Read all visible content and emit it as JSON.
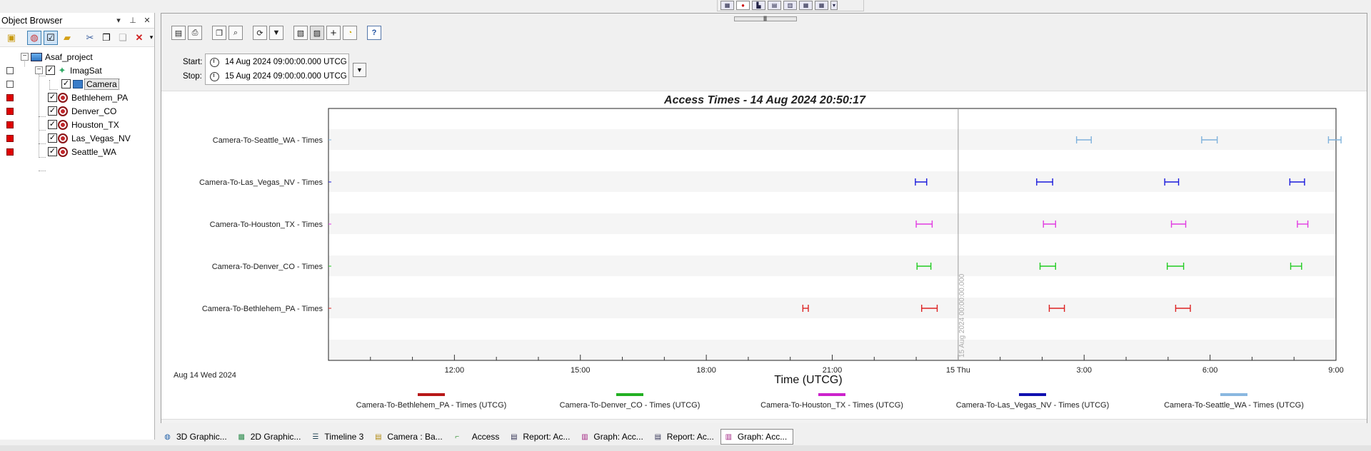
{
  "object_browser": {
    "title": "Object Browser",
    "title_controls": [
      "▾",
      "📌",
      "✕"
    ],
    "tree": [
      {
        "label": "Asaf_project",
        "icon": "project-icon",
        "status": "none",
        "level": 0
      },
      {
        "label": "ImagSat",
        "icon": "satellite-icon",
        "status": "white",
        "level": 1
      },
      {
        "label": "Camera",
        "icon": "sensor-icon",
        "status": "white",
        "level": 2
      },
      {
        "label": "Bethlehem_PA",
        "icon": "target-icon",
        "status": "red",
        "level": 1
      },
      {
        "label": "Denver_CO",
        "icon": "target-icon",
        "status": "red",
        "level": 1
      },
      {
        "label": "Houston_TX",
        "icon": "target-icon",
        "status": "red",
        "level": 1
      },
      {
        "label": "Las_Vegas_NV",
        "icon": "target-icon",
        "status": "red",
        "level": 1
      },
      {
        "label": "Seattle_WA",
        "icon": "target-icon",
        "status": "red",
        "level": 1
      }
    ]
  },
  "graph_window": {
    "start_label": "Start:",
    "stop_label": "Stop:",
    "start_time": "14 Aug 2024 09:00:00.000 UTCG",
    "stop_time": "15 Aug 2024 09:00:00.000 UTCG"
  },
  "chart_data": {
    "type": "gantt",
    "title": "Access Times - 14 Aug 2024 20:50:17",
    "xlabel": "Time (UTCG)",
    "date_label": "Aug 14 Wed 2024",
    "x_range": [
      "2024-08-14T09:00:00Z",
      "2024-08-15T09:00:00Z"
    ],
    "x_ticks": [
      "12:00",
      "15:00",
      "18:00",
      "21:00",
      "15 Thu",
      "3:00",
      "6:00",
      "9:00"
    ],
    "x_tick_hours": [
      3,
      6,
      9,
      12,
      15,
      18,
      21,
      24
    ],
    "marker": {
      "hours": 15,
      "label": "15 Aug 2024 00:00:00.000"
    },
    "series": [
      {
        "name": "Camera-To-Seattle_WA - Times",
        "color": "#7fb2dc",
        "intervals": [
          [
            17.82,
            18.17
          ],
          [
            20.8,
            21.17
          ],
          [
            23.82,
            24.12
          ]
        ]
      },
      {
        "name": "Camera-To-Las_Vegas_NV - Times",
        "color": "#1a1adc",
        "intervals": [
          [
            13.98,
            14.25
          ],
          [
            16.87,
            17.25
          ],
          [
            19.92,
            20.25
          ],
          [
            22.9,
            23.25
          ]
        ]
      },
      {
        "name": "Camera-To-Houston_TX - Times",
        "color": "#e23ce2",
        "intervals": [
          [
            14.0,
            14.38
          ],
          [
            17.03,
            17.32
          ],
          [
            20.08,
            20.42
          ],
          [
            23.08,
            23.33
          ]
        ]
      },
      {
        "name": "Camera-To-Denver_CO - Times",
        "color": "#22cc22",
        "intervals": [
          [
            14.02,
            14.35
          ],
          [
            16.95,
            17.32
          ],
          [
            19.98,
            20.37
          ],
          [
            22.92,
            23.18
          ]
        ]
      },
      {
        "name": "Camera-To-Bethlehem_PA - Times",
        "color": "#dd2222",
        "intervals": [
          [
            11.3,
            11.43
          ],
          [
            14.13,
            14.5
          ],
          [
            17.17,
            17.53
          ],
          [
            20.18,
            20.53
          ]
        ]
      }
    ],
    "legend": [
      {
        "label": "Camera-To-Bethlehem_PA - Times (UTCG)",
        "color": "#b81818"
      },
      {
        "label": "Camera-To-Denver_CO - Times (UTCG)",
        "color": "#22b022"
      },
      {
        "label": "Camera-To-Houston_TX - Times (UTCG)",
        "color": "#cc22cc"
      },
      {
        "label": "Camera-To-Las_Vegas_NV - Times (UTCG)",
        "color": "#1010b0"
      },
      {
        "label": "Camera-To-Seattle_WA - Times (UTCG)",
        "color": "#8ab8e0"
      }
    ],
    "legend_position": "bottom"
  },
  "tabs": [
    {
      "label": "3D Graphic...",
      "icon": "globe-icon"
    },
    {
      "label": "2D Graphic...",
      "icon": "map-icon"
    },
    {
      "label": "Timeline 3",
      "icon": "timeline-icon"
    },
    {
      "label": "Camera : Ba...",
      "icon": "report-icon"
    },
    {
      "label": "Access",
      "icon": "access-icon"
    },
    {
      "label": "Report:  Ac...",
      "icon": "report-icon"
    },
    {
      "label": "Graph:  Acc...",
      "icon": "graph-icon"
    },
    {
      "label": "Report:  Ac...",
      "icon": "report-icon"
    },
    {
      "label": "Graph:  Acc...",
      "icon": "graph-icon",
      "active": true
    }
  ]
}
